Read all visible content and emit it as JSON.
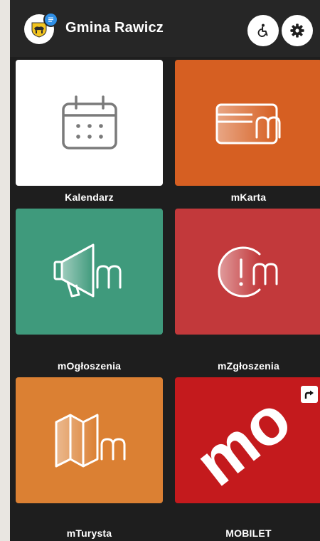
{
  "header": {
    "title": "Gmina Rawicz",
    "logo_icon": "rawicz-coat-of-arms-icon",
    "notification_icon": "message-icon",
    "accessibility_icon": "wheelchair-icon",
    "settings_icon": "gear-icon"
  },
  "tiles": [
    {
      "label": "Kalendarz",
      "icon": "calendar-icon",
      "color": "#ffffff"
    },
    {
      "label": "mKarta",
      "icon": "card-m-icon",
      "color": "#d65f22"
    },
    {
      "label": "mOgłoszenia",
      "icon": "megaphone-m-icon",
      "color": "#3f9a7c"
    },
    {
      "label": "mZgłoszenia",
      "icon": "alert-m-icon",
      "color": "#c2393b"
    },
    {
      "label": "mTurysta",
      "icon": "map-m-icon",
      "color": "#db8033"
    },
    {
      "label": "MOBILET",
      "icon": "mobilet-logo",
      "color": "#c41a1d",
      "logo_text": "mo",
      "external_icon": "external-link-icon"
    }
  ]
}
